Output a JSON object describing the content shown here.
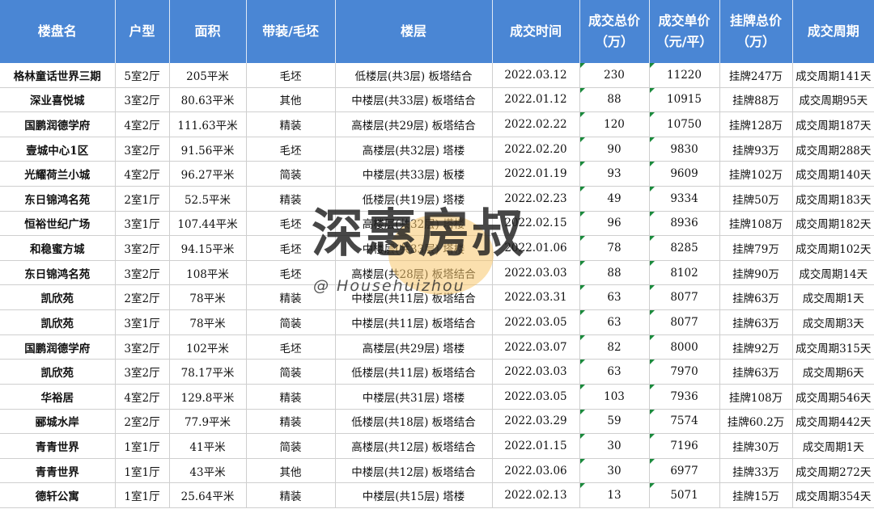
{
  "headers": [
    "楼盘名",
    "户型",
    "面积",
    "带装/毛坯",
    "楼层",
    "成交时间",
    "成交总价\n（万）",
    "成交单价\n（元/平）",
    "挂牌总价\n（万）",
    "成交周期"
  ],
  "rows": [
    [
      "格林童话世界三期",
      "5室2厅",
      "205平米",
      "毛坯",
      "低楼层(共3层) 板塔结合",
      "2022.03.12",
      "230",
      "11220",
      "挂牌247万",
      "成交周期141天"
    ],
    [
      "深业喜悦城",
      "3室2厅",
      "80.63平米",
      "其他",
      "中楼层(共33层) 板塔结合",
      "2022.01.12",
      "88",
      "10915",
      "挂牌88万",
      "成交周期95天"
    ],
    [
      "国鹏润德学府",
      "4室2厅",
      "111.63平米",
      "精装",
      "高楼层(共29层) 板塔结合",
      "2022.02.22",
      "120",
      "10750",
      "挂牌128万",
      "成交周期187天"
    ],
    [
      "壹城中心1区",
      "3室2厅",
      "91.56平米",
      "毛坯",
      "高楼层(共32层) 塔楼",
      "2022.02.20",
      "90",
      "9830",
      "挂牌93万",
      "成交周期288天"
    ],
    [
      "光耀荷兰小城",
      "4室2厅",
      "96.27平米",
      "简装",
      "中楼层(共33层) 板楼",
      "2022.01.19",
      "93",
      "9609",
      "挂牌102万",
      "成交周期140天"
    ],
    [
      "东日锦鸿名苑",
      "2室1厅",
      "52.5平米",
      "精装",
      "低楼层(共19层) 塔楼",
      "2022.02.23",
      "49",
      "9334",
      "挂牌50万",
      "成交周期183天"
    ],
    [
      "恒裕世纪广场",
      "3室1厅",
      "107.44平米",
      "毛坯",
      "高楼层(共32层) 塔楼",
      "2022.02.15",
      "96",
      "8936",
      "挂牌108万",
      "成交周期182天"
    ],
    [
      "和稳蜜方城",
      "3室2厅",
      "94.15平米",
      "毛坯",
      "中楼层(共33层) 塔楼",
      "2022.01.06",
      "78",
      "8285",
      "挂牌79万",
      "成交周期102天"
    ],
    [
      "东日锦鸿名苑",
      "3室2厅",
      "108平米",
      "毛坯",
      "高楼层(共28层) 板塔结合",
      "2022.03.03",
      "88",
      "8102",
      "挂牌90万",
      "成交周期14天"
    ],
    [
      "凯欣苑",
      "2室2厅",
      "78平米",
      "精装",
      "中楼层(共11层) 板塔结合",
      "2022.03.31",
      "63",
      "8077",
      "挂牌63万",
      "成交周期1天"
    ],
    [
      "凯欣苑",
      "3室1厅",
      "78平米",
      "简装",
      "中楼层(共11层) 板塔结合",
      "2022.03.05",
      "63",
      "8077",
      "挂牌63万",
      "成交周期3天"
    ],
    [
      "国鹏润德学府",
      "3室2厅",
      "102平米",
      "毛坯",
      "高楼层(共29层) 塔楼",
      "2022.03.07",
      "82",
      "8000",
      "挂牌92万",
      "成交周期315天"
    ],
    [
      "凯欣苑",
      "3室2厅",
      "78.17平米",
      "简装",
      "低楼层(共11层) 板塔结合",
      "2022.03.03",
      "63",
      "7970",
      "挂牌63万",
      "成交周期6天"
    ],
    [
      "华裕居",
      "4室2厅",
      "129.8平米",
      "精装",
      "中楼层(共31层) 塔楼",
      "2022.03.05",
      "103",
      "7936",
      "挂牌108万",
      "成交周期546天"
    ],
    [
      "郦城水岸",
      "2室2厅",
      "77.9平米",
      "精装",
      "低楼层(共18层) 板塔结合",
      "2022.03.29",
      "59",
      "7574",
      "挂牌60.2万",
      "成交周期442天"
    ],
    [
      "青青世界",
      "1室1厅",
      "41平米",
      "简装",
      "高楼层(共12层) 板塔结合",
      "2022.01.15",
      "30",
      "7196",
      "挂牌30万",
      "成交周期1天"
    ],
    [
      "青青世界",
      "1室1厅",
      "43平米",
      "其他",
      "中楼层(共12层) 板塔结合",
      "2022.03.06",
      "30",
      "6977",
      "挂牌33万",
      "成交周期272天"
    ],
    [
      "德轩公寓",
      "1室1厅",
      "25.64平米",
      "精装",
      "中楼层(共15层) 塔楼",
      "2022.02.13",
      "13",
      "5071",
      "挂牌15万",
      "成交周期354天"
    ]
  ],
  "watermark": {
    "title": "深惠房叔",
    "handle": "@ Househuizhou"
  },
  "colors": {
    "header_bg": "#4a86d4",
    "header_text": "#ffffff",
    "grid": "#cfcfcf",
    "number_marker": "#1a8a3c",
    "watermark_accent": "#f7c76b"
  }
}
